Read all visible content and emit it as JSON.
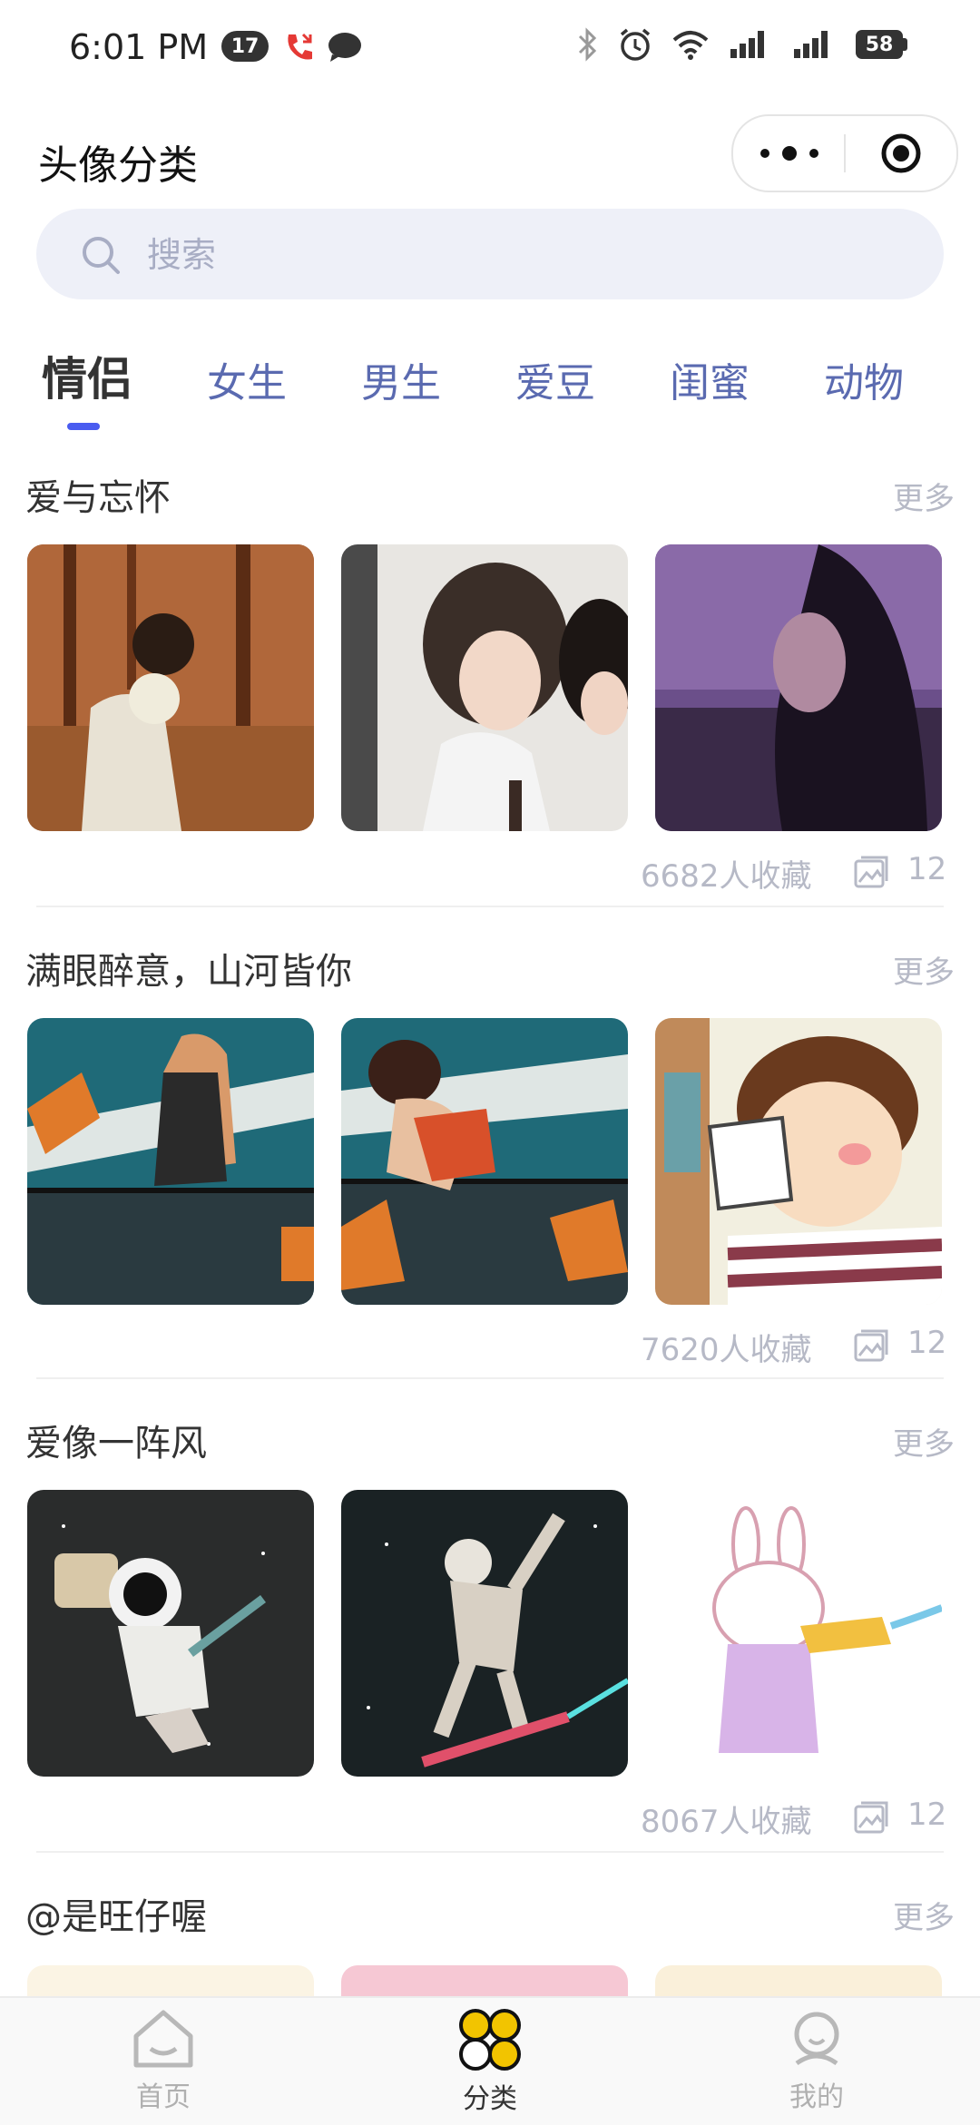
{
  "status_bar": {
    "time": "6:01 PM",
    "badge_count": "17",
    "battery": "58"
  },
  "header": {
    "title": "头像分类"
  },
  "search": {
    "placeholder": "搜索"
  },
  "tabs": [
    {
      "label": "情侣",
      "active": true
    },
    {
      "label": "女生"
    },
    {
      "label": "男生"
    },
    {
      "label": "爱豆"
    },
    {
      "label": "闺蜜"
    },
    {
      "label": "动物"
    }
  ],
  "sections": [
    {
      "title": "爱与忘怀",
      "more": "更多",
      "favorites": "6682人收藏",
      "count": "12"
    },
    {
      "title": "满眼醉意，山河皆你",
      "more": "更多",
      "favorites": "7620人收藏",
      "count": "12"
    },
    {
      "title": "爱像一阵风",
      "more": "更多",
      "favorites": "8067人收藏",
      "count": "12"
    },
    {
      "title": "@是旺仔喔",
      "more": "更多"
    }
  ],
  "tabbar": {
    "items": [
      {
        "label": "首页",
        "icon": "home-icon"
      },
      {
        "label": "分类",
        "icon": "category-icon",
        "active": true
      },
      {
        "label": "我的",
        "icon": "profile-icon"
      }
    ]
  },
  "colors": {
    "accent": "#4a5cf0",
    "tab_inactive": "#5a6ab0",
    "muted": "#b6b9c6",
    "search_bg": "#eef0f8"
  }
}
